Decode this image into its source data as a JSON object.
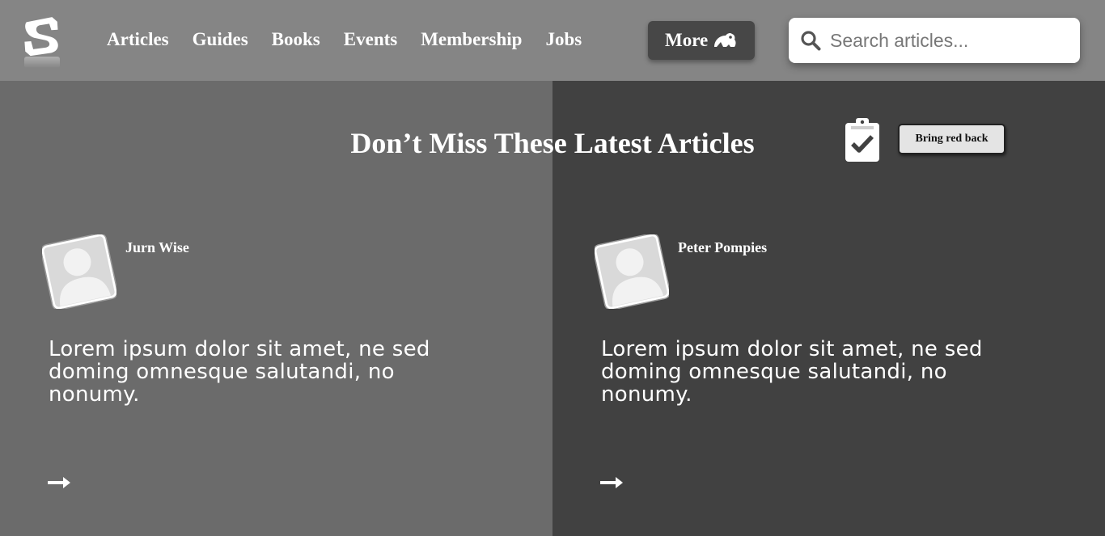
{
  "header": {
    "logo_icon": "s-logo-icon",
    "nav": [
      "Articles",
      "Guides",
      "Books",
      "Events",
      "Membership",
      "Jobs"
    ],
    "more_label": "More",
    "more_icon": "frog-icon",
    "search": {
      "placeholder": "Search articles...",
      "value": "",
      "icon": "search-icon"
    }
  },
  "section": {
    "title": "Don’t Miss These Latest Articles",
    "clipboard_icon": "clipboard-check-icon",
    "red_button_label": "Bring red back"
  },
  "articles": [
    {
      "author": "Jurn Wise",
      "excerpt": "Lorem ipsum dolor sit amet, ne sed doming omnesque salutandi, no nonumy.",
      "arrow_icon": "arrow-right-icon"
    },
    {
      "author": "Peter Pompies",
      "excerpt": "Lorem ipsum dolor sit amet, ne sed doming omnesque salutandi, no nonumy.",
      "arrow_icon": "arrow-right-icon"
    }
  ],
  "colors": {
    "header_bg": "#858585",
    "left_panel_bg": "#6b6b6b",
    "right_panel_bg": "#414141",
    "more_button_bg": "#474747"
  }
}
